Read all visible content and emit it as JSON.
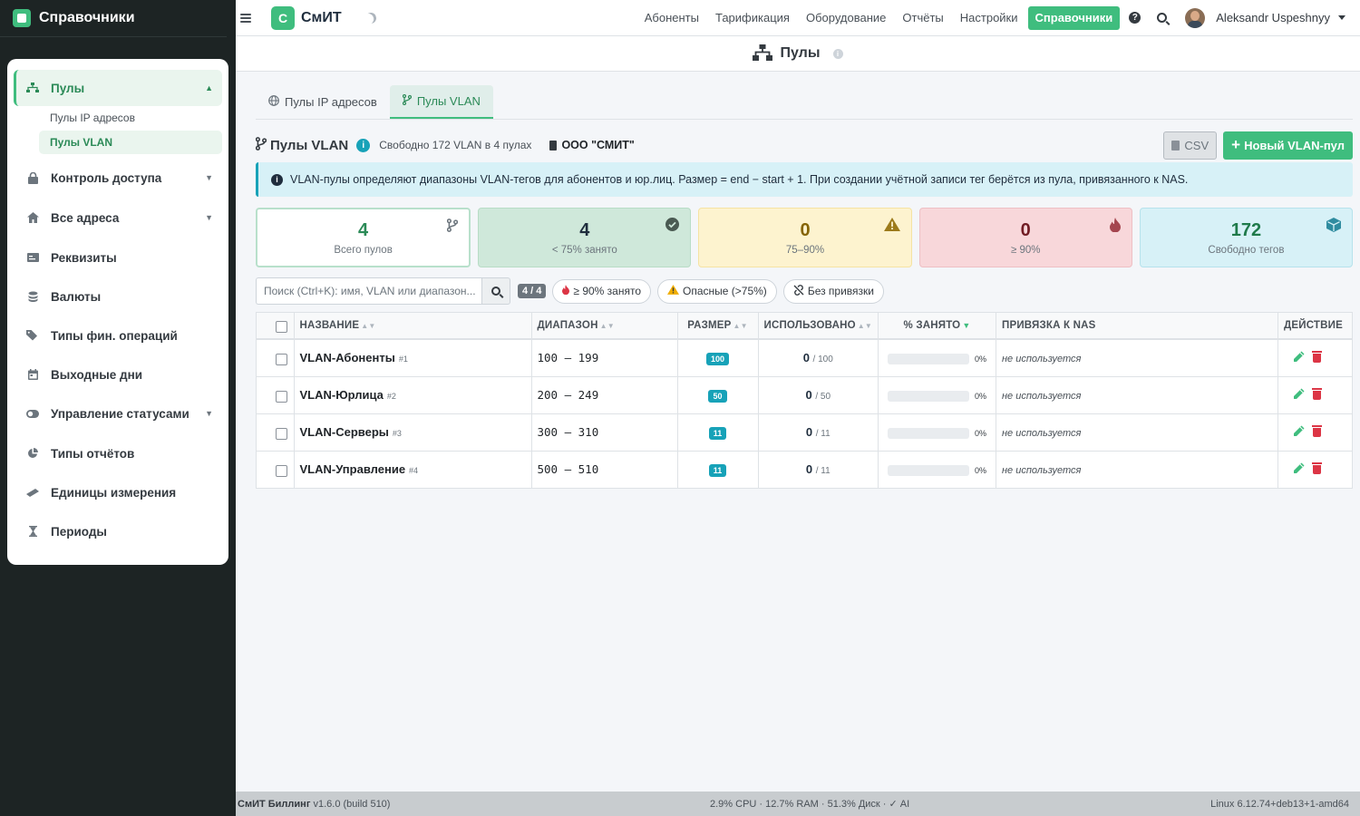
{
  "sidebar": {
    "brand": "Справочники",
    "items": [
      {
        "label": "Пулы",
        "icon": "sitemap-icon"
      },
      {
        "label": "Контроль доступа",
        "icon": "lock-icon"
      },
      {
        "label": "Все адреса",
        "icon": "home-icon"
      },
      {
        "label": "Реквизиты",
        "icon": "id-card-icon"
      },
      {
        "label": "Валюты",
        "icon": "coins-icon"
      },
      {
        "label": "Типы фин. операций",
        "icon": "tags-icon"
      },
      {
        "label": "Выходные дни",
        "icon": "calendar-icon"
      },
      {
        "label": "Управление статусами",
        "icon": "toggle-icon"
      },
      {
        "label": "Типы отчётов",
        "icon": "chart-pie-icon"
      },
      {
        "label": "Единицы измерения",
        "icon": "ruler-icon"
      },
      {
        "label": "Периоды",
        "icon": "hourglass-icon"
      }
    ],
    "sub_items": [
      "Пулы IP адресов",
      "Пулы VLAN"
    ]
  },
  "topbar": {
    "logo_letter": "С",
    "brand": "СмИТ",
    "links": [
      "Абоненты",
      "Тарификация",
      "Оборудование",
      "Отчёты",
      "Настройки"
    ],
    "active_link": "Справочники",
    "user": "Aleksandr Uspeshnyy"
  },
  "page": {
    "title": "Пулы"
  },
  "tabs": [
    "Пулы IP адресов",
    "Пулы VLAN"
  ],
  "section": {
    "title": "Пулы VLAN",
    "free_text": "Свободно 172 VLAN в 4 пулах",
    "org": "ООО \"СМИТ\"",
    "csv_label": "CSV",
    "new_label": "Новый VLAN-пул"
  },
  "alert": "VLAN-пулы определяют диапазоны VLAN-тегов для абонентов и юр.лиц. Размер = end − start + 1. При создании учётной записи тег берётся из пула, привязанного к NAS.",
  "stats": [
    {
      "value": "4",
      "caption": "Всего пулов"
    },
    {
      "value": "4",
      "caption": "< 75% занято"
    },
    {
      "value": "0",
      "caption": "75–90%"
    },
    {
      "value": "0",
      "caption": "≥ 90%"
    },
    {
      "value": "172",
      "caption": "Свободно тегов"
    }
  ],
  "filters": {
    "search_placeholder": "Поиск (Ctrl+K): имя, VLAN или диапазон...",
    "count": "4 / 4",
    "chips": [
      "≥ 90% занято",
      "Опасные (>75%)",
      "Без привязки"
    ]
  },
  "table": {
    "headers": [
      "НАЗВАНИЕ",
      "ДИАПАЗОН",
      "РАЗМЕР",
      "ИСПОЛЬЗОВАНО",
      "% ЗАНЯТО",
      "ПРИВЯЗКА К NAS",
      "ДЕЙСТВИЕ"
    ],
    "rows": [
      {
        "name": "VLAN-Абоненты",
        "id": "#1",
        "range": "100 — 199",
        "size": "100",
        "used": "0",
        "total": "/ 100",
        "pct": "0%",
        "pct_value": 0,
        "nas": "не используется"
      },
      {
        "name": "VLAN-Юрлица",
        "id": "#2",
        "range": "200 — 249",
        "size": "50",
        "used": "0",
        "total": "/ 50",
        "pct": "0%",
        "pct_value": 0,
        "nas": "не используется"
      },
      {
        "name": "VLAN-Серверы",
        "id": "#3",
        "range": "300 — 310",
        "size": "11",
        "used": "0",
        "total": "/ 11",
        "pct": "0%",
        "pct_value": 0,
        "nas": "не используется"
      },
      {
        "name": "VLAN-Управление",
        "id": "#4",
        "range": "500 — 510",
        "size": "11",
        "used": "0",
        "total": "/ 11",
        "pct": "0%",
        "pct_value": 0,
        "nas": "не используется"
      }
    ]
  },
  "footer": {
    "app": "СмИТ Биллинг",
    "version": "v1.6.0 (build 510)",
    "stats": "2.9% CPU · 12.7% RAM · 51.3% Диск · ✓ AI",
    "kernel": "Linux 6.12.74+deb13+1-amd64"
  },
  "colors": {
    "accent": "#3fbd7e",
    "info": "#17a2b8",
    "danger": "#dc3545",
    "sidebar_bg": "#1d2424"
  }
}
